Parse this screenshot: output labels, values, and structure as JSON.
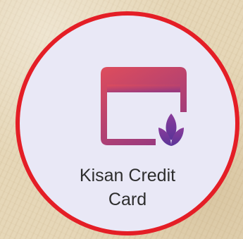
{
  "tile": {
    "label_line1": "Kisan Credit",
    "label_line2": "Card",
    "icon": "credit-card-leaf-icon"
  },
  "colors": {
    "ring": "#e41e26",
    "tile_background": "#e9e8f6",
    "icon_top": "#d94a5e",
    "icon_bottom": "#6a3aa0",
    "label_text": "#2d2d2d"
  }
}
